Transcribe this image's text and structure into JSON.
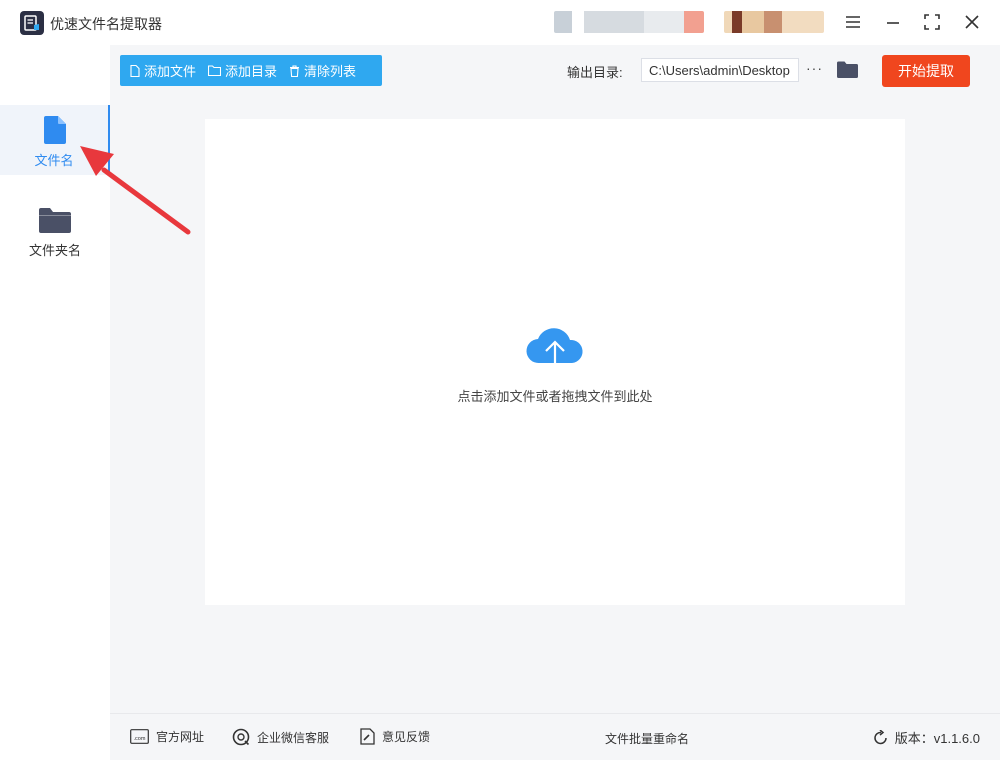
{
  "window": {
    "title": "优速文件名提取器",
    "controls": {
      "menu_icon": "menu-icon",
      "minimize_icon": "minimize-icon",
      "maximize_icon": "maximize-icon",
      "close_icon": "close-icon"
    }
  },
  "sidebar": {
    "items": [
      {
        "label": "文件名",
        "icon": "file-icon",
        "active": true
      },
      {
        "label": "文件夹名",
        "icon": "folder-icon",
        "active": false
      }
    ]
  },
  "toolbar": {
    "add_file": "添加文件",
    "add_dir": "添加目录",
    "clear_list": "清除列表",
    "output_label": "输出目录:",
    "output_path": "C:\\Users\\admin\\Desktop",
    "more": "···",
    "start": "开始提取"
  },
  "dropzone": {
    "hint": "点击添加文件或者拖拽文件到此处",
    "icon": "cloud-upload-icon"
  },
  "footer": {
    "website": "官方网址",
    "wechat": "企业微信客服",
    "feedback": "意见反馈",
    "center": "文件批量重命名",
    "version": "版本：v1.1.6.0"
  },
  "colors": {
    "accent": "#2fa8f0",
    "start": "#f0461e",
    "active_tab": "#2f8bf0",
    "arrow": "#e8383d",
    "icon_dark": "#4a5066"
  }
}
